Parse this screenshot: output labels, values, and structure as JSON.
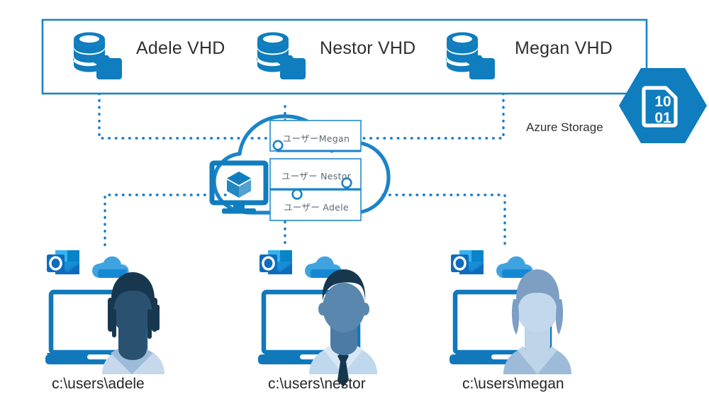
{
  "diagram": {
    "title": "Azure Storage FSLogix profile container architecture",
    "colors": {
      "azure_blue": "#0F7DBE",
      "deep_blue": "#1168A8",
      "outline_blue": "#1B83C8",
      "box_border": "#2E8FD0",
      "dotted": "#1878C8",
      "text_dark": "#262626",
      "label_gray": "#5A6A76",
      "outlook_blue": "#0F6CBD",
      "outlook_light": "#28A8EA",
      "onedrive_light": "#3FA3E0",
      "onedrive_dark": "#1588D4",
      "skin_dark": "#1F3F5E",
      "hair_dark": "#17374F",
      "shirt_light": "#AFCBE8",
      "shirt_mid": "#9DBBD9",
      "person_light": "#A9C4E2",
      "person_mid": "#7E9FC4"
    }
  },
  "storage": {
    "label": "Azure Storage",
    "badge_icon": "binary-document-hexagon-icon",
    "badge_top_digits": "10",
    "badge_bottom_digits": "01",
    "vhds": [
      {
        "label": "Adele VHD",
        "icon": "database-folder-icon"
      },
      {
        "label": "Nestor VHD",
        "icon": "database-folder-icon"
      },
      {
        "label": "Megan VHD",
        "icon": "database-folder-icon"
      }
    ]
  },
  "cloud": {
    "icon": "cloud-outline-icon",
    "vm_icon": "virtual-machine-monitor-icon",
    "session_boxes": [
      {
        "label": "ユーザーMegan"
      },
      {
        "label": "ユーザー Nestor"
      },
      {
        "label": "ユーザー Adele"
      }
    ]
  },
  "workstations": [
    {
      "path": "c:\\users\\adele",
      "app_icon": "outlook-icon",
      "cloud_icon": "onedrive-icon",
      "device_icon": "laptop-icon",
      "person_icon": "person-avatar-icon"
    },
    {
      "path": "c:\\users\\nestor",
      "app_icon": "outlook-icon",
      "cloud_icon": "onedrive-icon",
      "device_icon": "laptop-icon",
      "person_icon": "person-avatar-icon"
    },
    {
      "path": "c:\\users\\megan",
      "app_icon": "outlook-icon",
      "cloud_icon": "onedrive-icon",
      "device_icon": "laptop-icon",
      "person_icon": "person-avatar-icon"
    }
  ]
}
